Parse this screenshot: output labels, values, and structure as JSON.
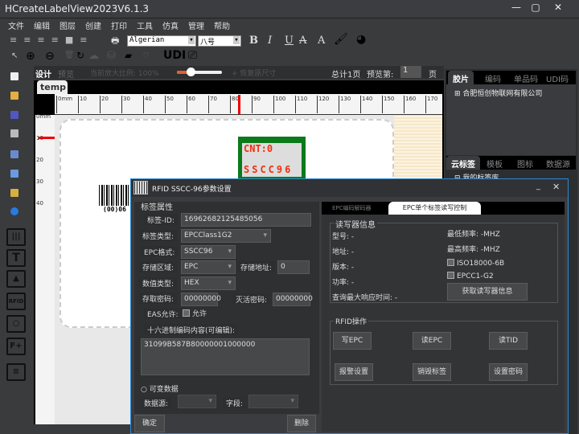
{
  "app": {
    "title": "HCreateLabelView2023V6.1.3"
  },
  "menu": [
    "文件",
    "编辑",
    "图层",
    "创建",
    "打印",
    "工具",
    "仿真",
    "管理",
    "帮助"
  ],
  "toolbar": {
    "font": "Algerian",
    "size": "八号",
    "bold": "B",
    "italic": "I",
    "underline": "U",
    "strike": "A",
    "font_a": "A",
    "udi": "UDI"
  },
  "designbar": {
    "design": "设计",
    "preview": "预览",
    "zoom_label": "当前放大比例: 100%",
    "zoom_value": 0.3,
    "restore": "+ 恢复原尺寸",
    "total": "总计1页",
    "preview_page": "预览第:",
    "page": "1",
    "page_unit": "页"
  },
  "canvas": {
    "tab": "temp",
    "ruler_top": [
      "0mm",
      "10",
      "20",
      "30",
      "40",
      "50",
      "60",
      "70",
      "80",
      "90",
      "100",
      "110",
      "120",
      "130",
      "140",
      "150",
      "160",
      "170"
    ],
    "ruler_left": [
      "0mm",
      "10",
      "20",
      "30",
      "40"
    ],
    "rfid_cnt": "CNT:0",
    "rfid_text": "SSCC96",
    "barcode_text": "(00)06"
  },
  "leftbar": {
    "rfid_label": "RFID"
  },
  "rightpanel": {
    "tabs1": [
      "胶片",
      "编码",
      "单品码",
      "UDI码"
    ],
    "tree_item": "合肥恒创物联网有限公司",
    "tabs2": [
      "云标签",
      "模板",
      "图标",
      "数据源"
    ],
    "tree_item2": "我的标签库"
  },
  "dialog": {
    "title": "RFID  SSCC-96参数设置",
    "props": {
      "group": "标签属性",
      "id_label": "标签-ID:",
      "id": "16962682125485056",
      "type_label": "标签类型:",
      "type": "EPCClass1G2",
      "fmt_label": "EPC格式:",
      "fmt": "SSCC96",
      "area_label": "存储区域:",
      "area": "EPC",
      "addr_label": "存储地址:",
      "addr": "0",
      "dtype_label": "数值类型:",
      "dtype": "HEX",
      "access_label": "存取密码:",
      "access": "00000000",
      "kill_label": "灭活密码:",
      "kill": "00000000",
      "eas_label": "EAS允许:",
      "eas_check": "允许",
      "hex_label": "十六进制编码内容(可编辑):",
      "hex": "31099B587B80000001000000",
      "variable": "可变数据",
      "source_label": "数据源:",
      "field_label": "字段:"
    },
    "ok": "确定",
    "delete": "删除",
    "tabs": [
      "EPC编码解码器",
      "EPC单个标签读写控制"
    ],
    "reader": {
      "group": "读写器信息",
      "model": "型号:  -",
      "addr": "地址:  -",
      "version": "版本:  -",
      "power": "功率:  -",
      "resp": "查询最大响应时间:    -",
      "minf": "最低频率:    -MHZ",
      "maxf": "最高频率:    -MHZ",
      "iso": "ISO18000-6B",
      "epc": "EPCC1-G2",
      "get": "获取读写器信息"
    },
    "ops": {
      "group": "RFID操作",
      "buttons": [
        "写EPC",
        "读EPC",
        "读TID",
        "报警设置",
        "销毁标签",
        "设置密码"
      ]
    }
  }
}
